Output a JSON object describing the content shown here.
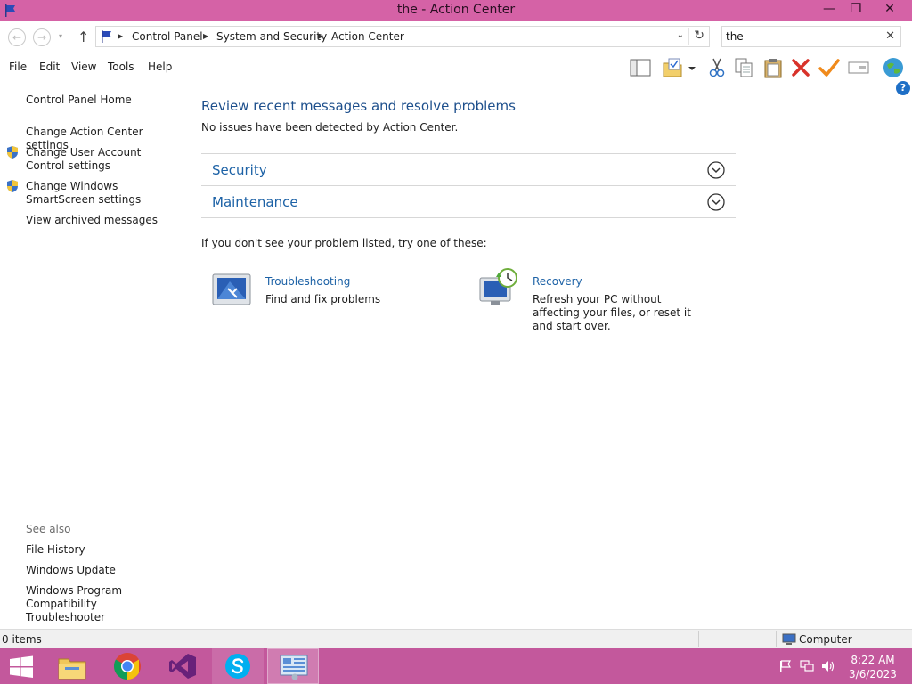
{
  "window": {
    "title": "the - Action Center",
    "minimize": "—",
    "restore": "❐",
    "close": "✕"
  },
  "nav": {
    "back": "←",
    "forward": "→",
    "recent": "▾",
    "up": "↑",
    "breadcrumb": [
      "Control Panel",
      "System and Security",
      "Action Center"
    ],
    "address_dropdown": "⌄",
    "refresh": "↻"
  },
  "search": {
    "value": "the",
    "clear": "✕"
  },
  "menu": [
    "File",
    "Edit",
    "View",
    "Tools",
    "Help"
  ],
  "toolbar_icons": [
    "layout-icon",
    "folder-options-icon",
    "cut-icon",
    "copy-icon",
    "paste-icon",
    "delete-icon",
    "checkmark-icon",
    "rename-icon",
    "globe-icon"
  ],
  "help": "?",
  "sidebar": {
    "home": "Control Panel Home",
    "links": [
      "Change Action Center settings",
      "Change User Account Control settings",
      "Change Windows SmartScreen settings",
      "View archived messages"
    ],
    "see_also_header": "See also",
    "see_also": [
      "File History",
      "Windows Update",
      "Windows Program Compatibility Troubleshooter"
    ]
  },
  "main": {
    "title": "Review recent messages and resolve problems",
    "subtitle": "No issues have been detected by Action Center.",
    "sections": [
      "Security",
      "Maintenance"
    ],
    "try_line": "If you don't see your problem listed, try one of these:",
    "options": [
      {
        "title": "Troubleshooting",
        "desc": "Find and fix problems"
      },
      {
        "title": "Recovery",
        "desc": "Refresh your PC without affecting your files, or reset it and start over."
      }
    ]
  },
  "status": {
    "items": "0 items",
    "location": "Computer"
  },
  "taskbar": {
    "apps": [
      "start",
      "file-explorer",
      "chrome",
      "visual-studio",
      "skype",
      "control-panel"
    ],
    "time": "8:22 AM",
    "date": "3/6/2023"
  },
  "colors": {
    "titlebar": "#d562a6",
    "taskbar": "#c3589c",
    "link": "#1d62a6",
    "heading": "#1d4f8c"
  }
}
